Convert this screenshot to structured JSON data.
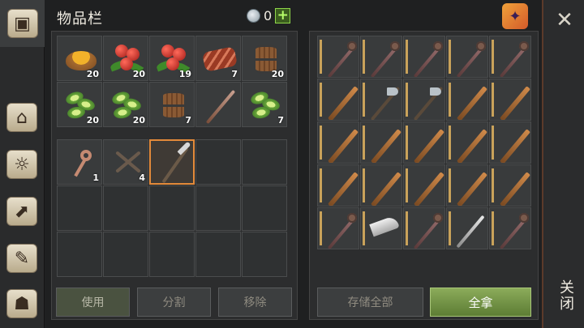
{
  "header": {
    "title": "物品栏",
    "currency_count": "0",
    "plus_label": "+"
  },
  "close": {
    "x_label": "✕",
    "label": "关闭"
  },
  "nav": [
    {
      "name": "nav-chest-icon",
      "glyph": "▣"
    },
    {
      "name": "nav-base-icon",
      "glyph": "⌂"
    },
    {
      "name": "nav-journal-icon",
      "glyph": "☼"
    },
    {
      "name": "nav-map-icon",
      "glyph": "⬈"
    },
    {
      "name": "nav-quest-icon",
      "glyph": "✎"
    },
    {
      "name": "nav-backpack-icon",
      "glyph": "☗"
    }
  ],
  "inventory": [
    {
      "item": "soup-bowl",
      "qty": "20"
    },
    {
      "item": "berries",
      "qty": "20"
    },
    {
      "item": "berries",
      "qty": "19"
    },
    {
      "item": "raw-meat",
      "qty": "7"
    },
    {
      "item": "barrel",
      "qty": "20"
    },
    {
      "item": "cactus-melon",
      "qty": "20"
    },
    {
      "item": "cactus-melon",
      "qty": "20"
    },
    {
      "item": "barrel",
      "qty": "7"
    },
    {
      "item": "spear",
      "qty": ""
    },
    {
      "item": "cactus-melon",
      "qty": "7"
    }
  ],
  "bag": [
    {
      "item": "key",
      "qty": "1"
    },
    {
      "item": "nails",
      "qty": "4"
    },
    {
      "item": "pickaxe",
      "qty": "",
      "selected": true
    },
    {
      "item": "",
      "qty": ""
    },
    {
      "item": "",
      "qty": ""
    },
    {
      "item": "",
      "qty": ""
    },
    {
      "item": "",
      "qty": ""
    },
    {
      "item": "",
      "qty": ""
    },
    {
      "item": "",
      "qty": ""
    },
    {
      "item": "",
      "qty": ""
    },
    {
      "item": "",
      "qty": ""
    },
    {
      "item": "",
      "qty": ""
    },
    {
      "item": "",
      "qty": ""
    },
    {
      "item": "",
      "qty": ""
    },
    {
      "item": "",
      "qty": ""
    }
  ],
  "loot": [
    "mace",
    "mace",
    "mace",
    "mace",
    "mace",
    "club",
    "axe",
    "axe",
    "club",
    "club",
    "club",
    "club",
    "club",
    "club",
    "club",
    "club",
    "club",
    "club",
    "club",
    "club",
    "mace",
    "machete",
    "mace",
    "sword",
    "mace"
  ],
  "buttons": {
    "use": "使用",
    "split": "分割",
    "remove": "移除",
    "store_all": "存储全部",
    "take_all": "全拿"
  },
  "colors": {
    "accent_green": "#8ed64a",
    "selected_orange": "#e38a3a"
  }
}
